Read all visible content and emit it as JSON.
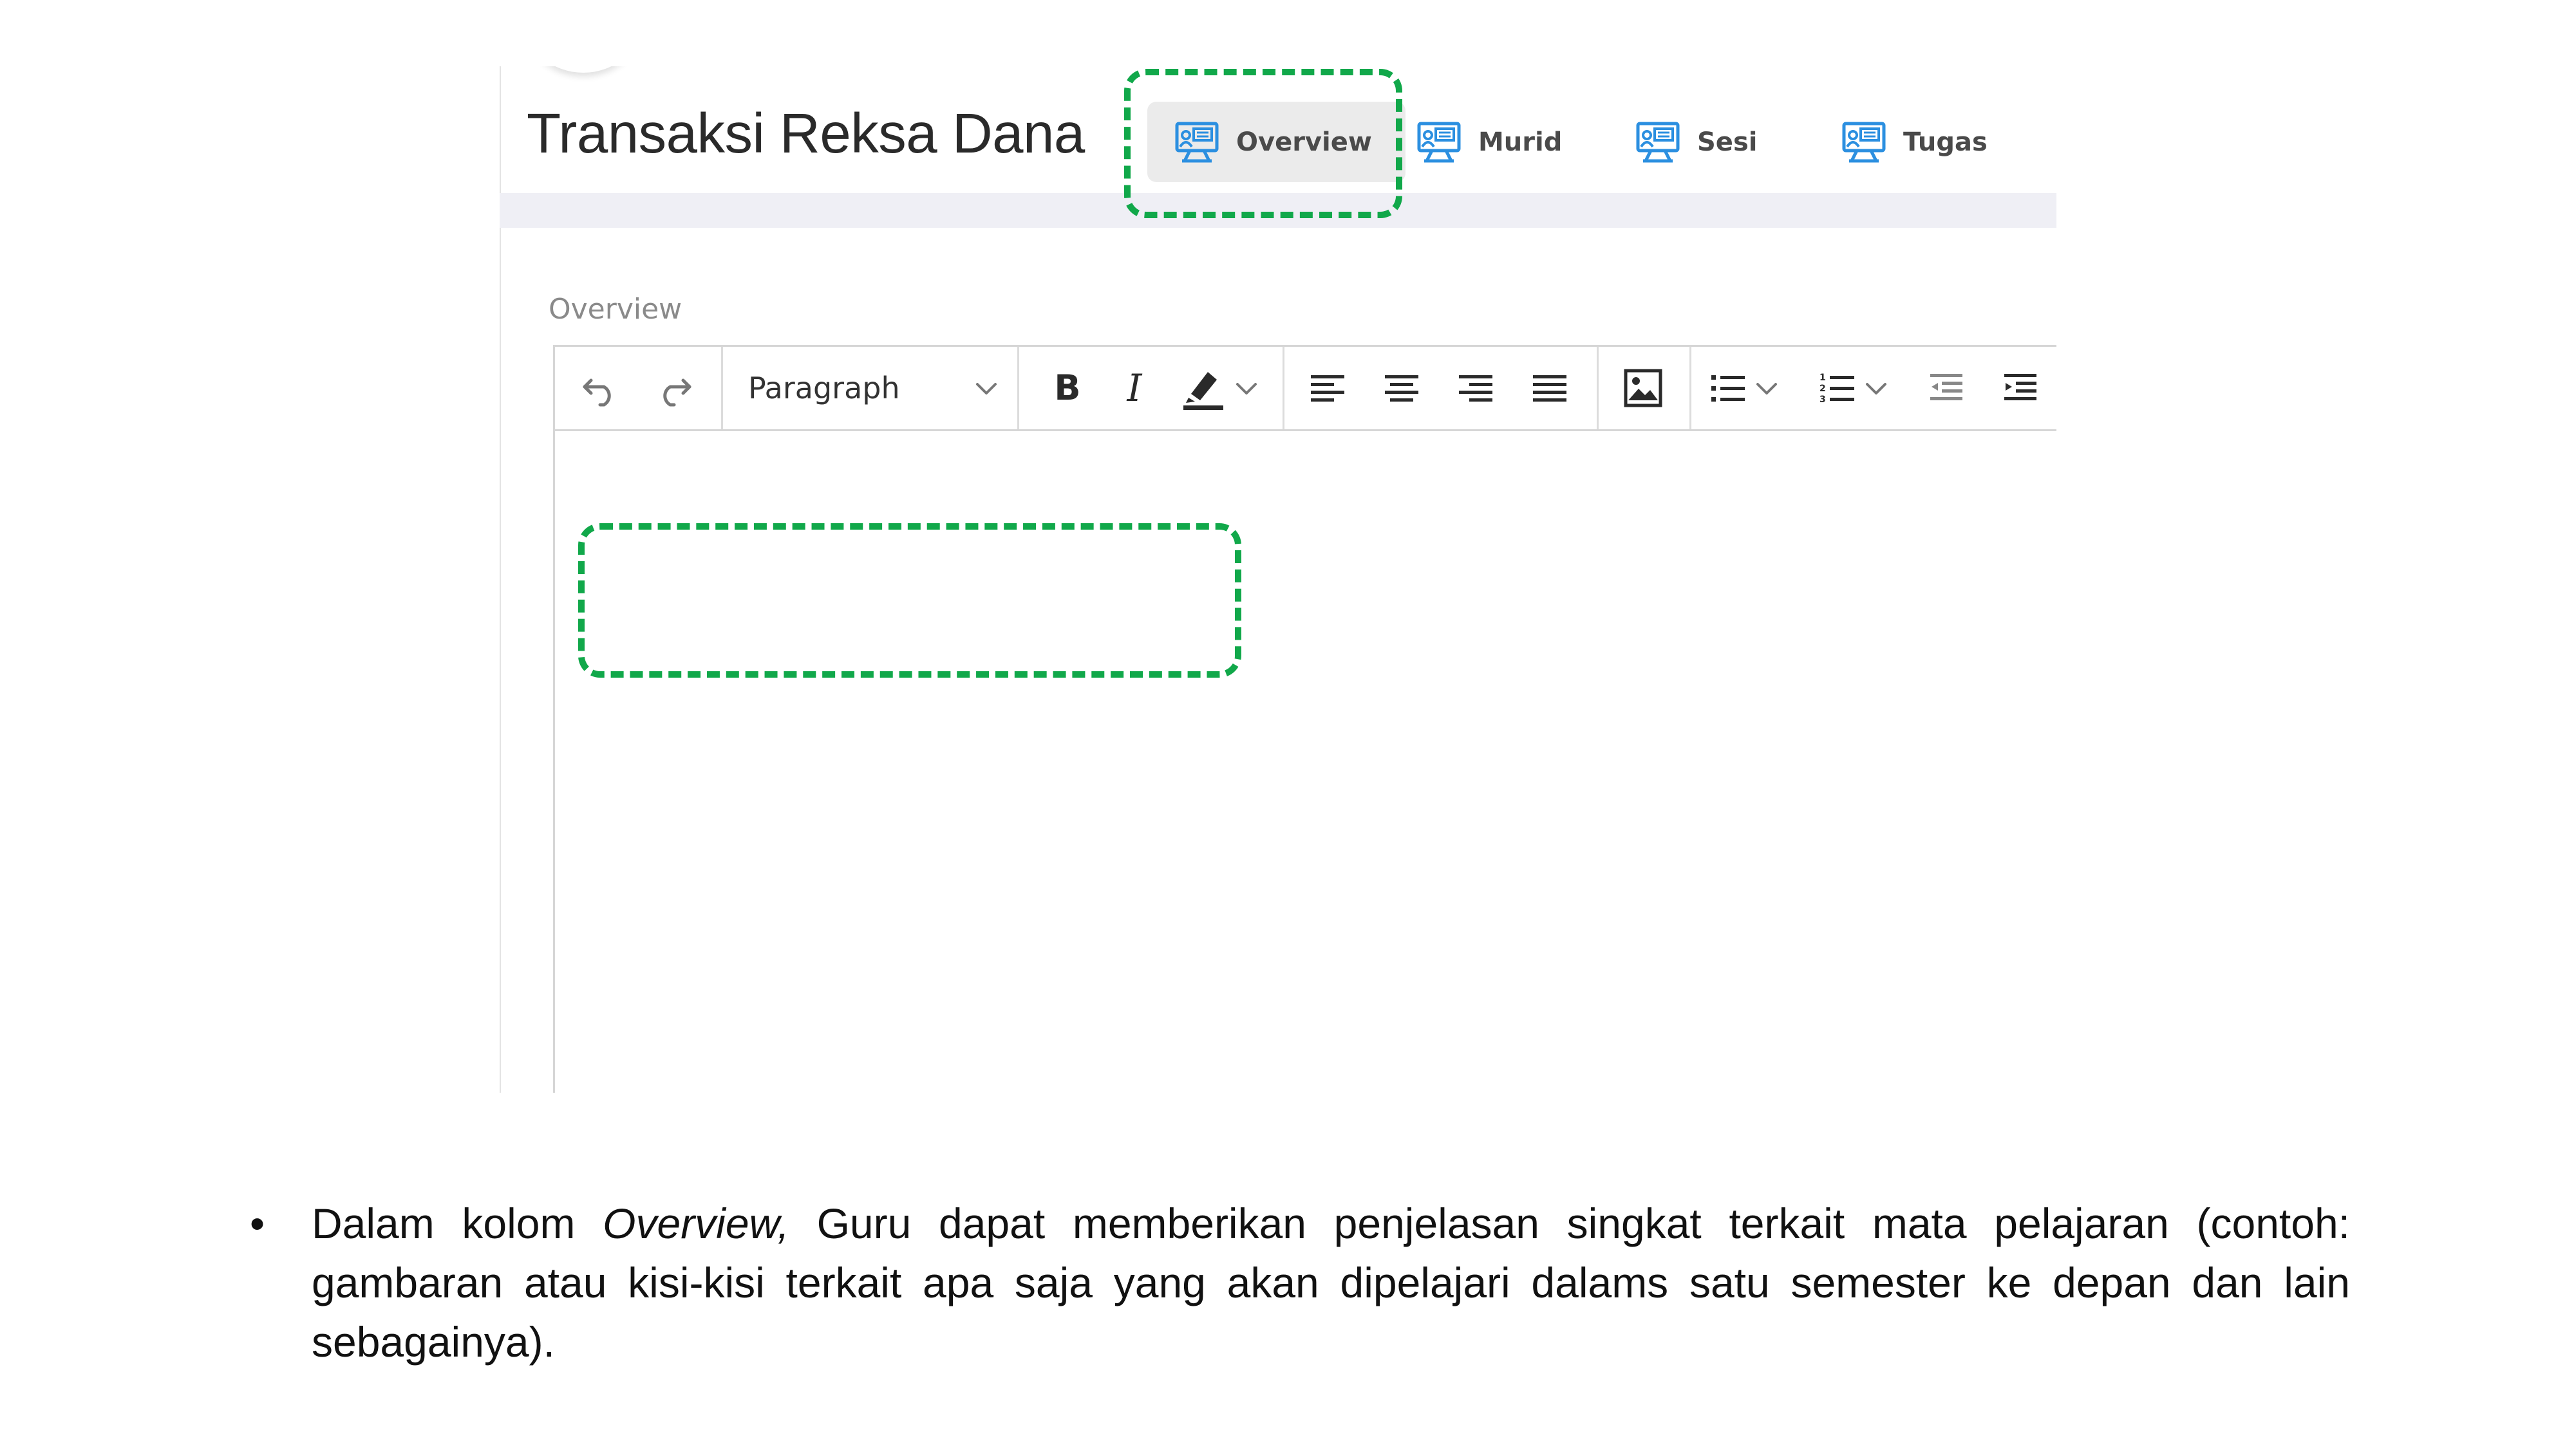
{
  "course": {
    "title": "Transaksi Reksa Dana"
  },
  "tabs": [
    {
      "label": "Overview",
      "icon": "monitor-icon",
      "active": true
    },
    {
      "label": "Murid",
      "icon": "monitor-icon",
      "active": false
    },
    {
      "label": "Sesi",
      "icon": "monitor-icon",
      "active": false
    },
    {
      "label": "Tugas",
      "icon": "monitor-icon",
      "active": false
    }
  ],
  "editor": {
    "field_label": "Overview",
    "format_select": {
      "value": "Paragraph"
    },
    "toolbar_icons": [
      "undo-icon",
      "redo-icon",
      "bold-icon",
      "italic-icon",
      "highlight-icon",
      "align-left-icon",
      "align-center-icon",
      "align-right-icon",
      "align-justify-icon",
      "insert-image-icon",
      "bulleted-list-icon",
      "numbered-list-icon",
      "outdent-icon",
      "indent-icon"
    ],
    "content": ""
  },
  "caption": {
    "bullet": "•",
    "before": "Dalam kolom ",
    "emphasis": "Overview,",
    "after": " Guru dapat memberikan penjelasan singkat terkait mata pelajaran (contoh: gambaran atau kisi-kisi terkait apa saja yang akan dipelajari dalams satu semester ke depan dan lain sebagainya)."
  },
  "colors": {
    "highlight": "#11a84a",
    "icon_blue": "#2b8fe0",
    "active_tab_bg": "#ebebeb"
  }
}
